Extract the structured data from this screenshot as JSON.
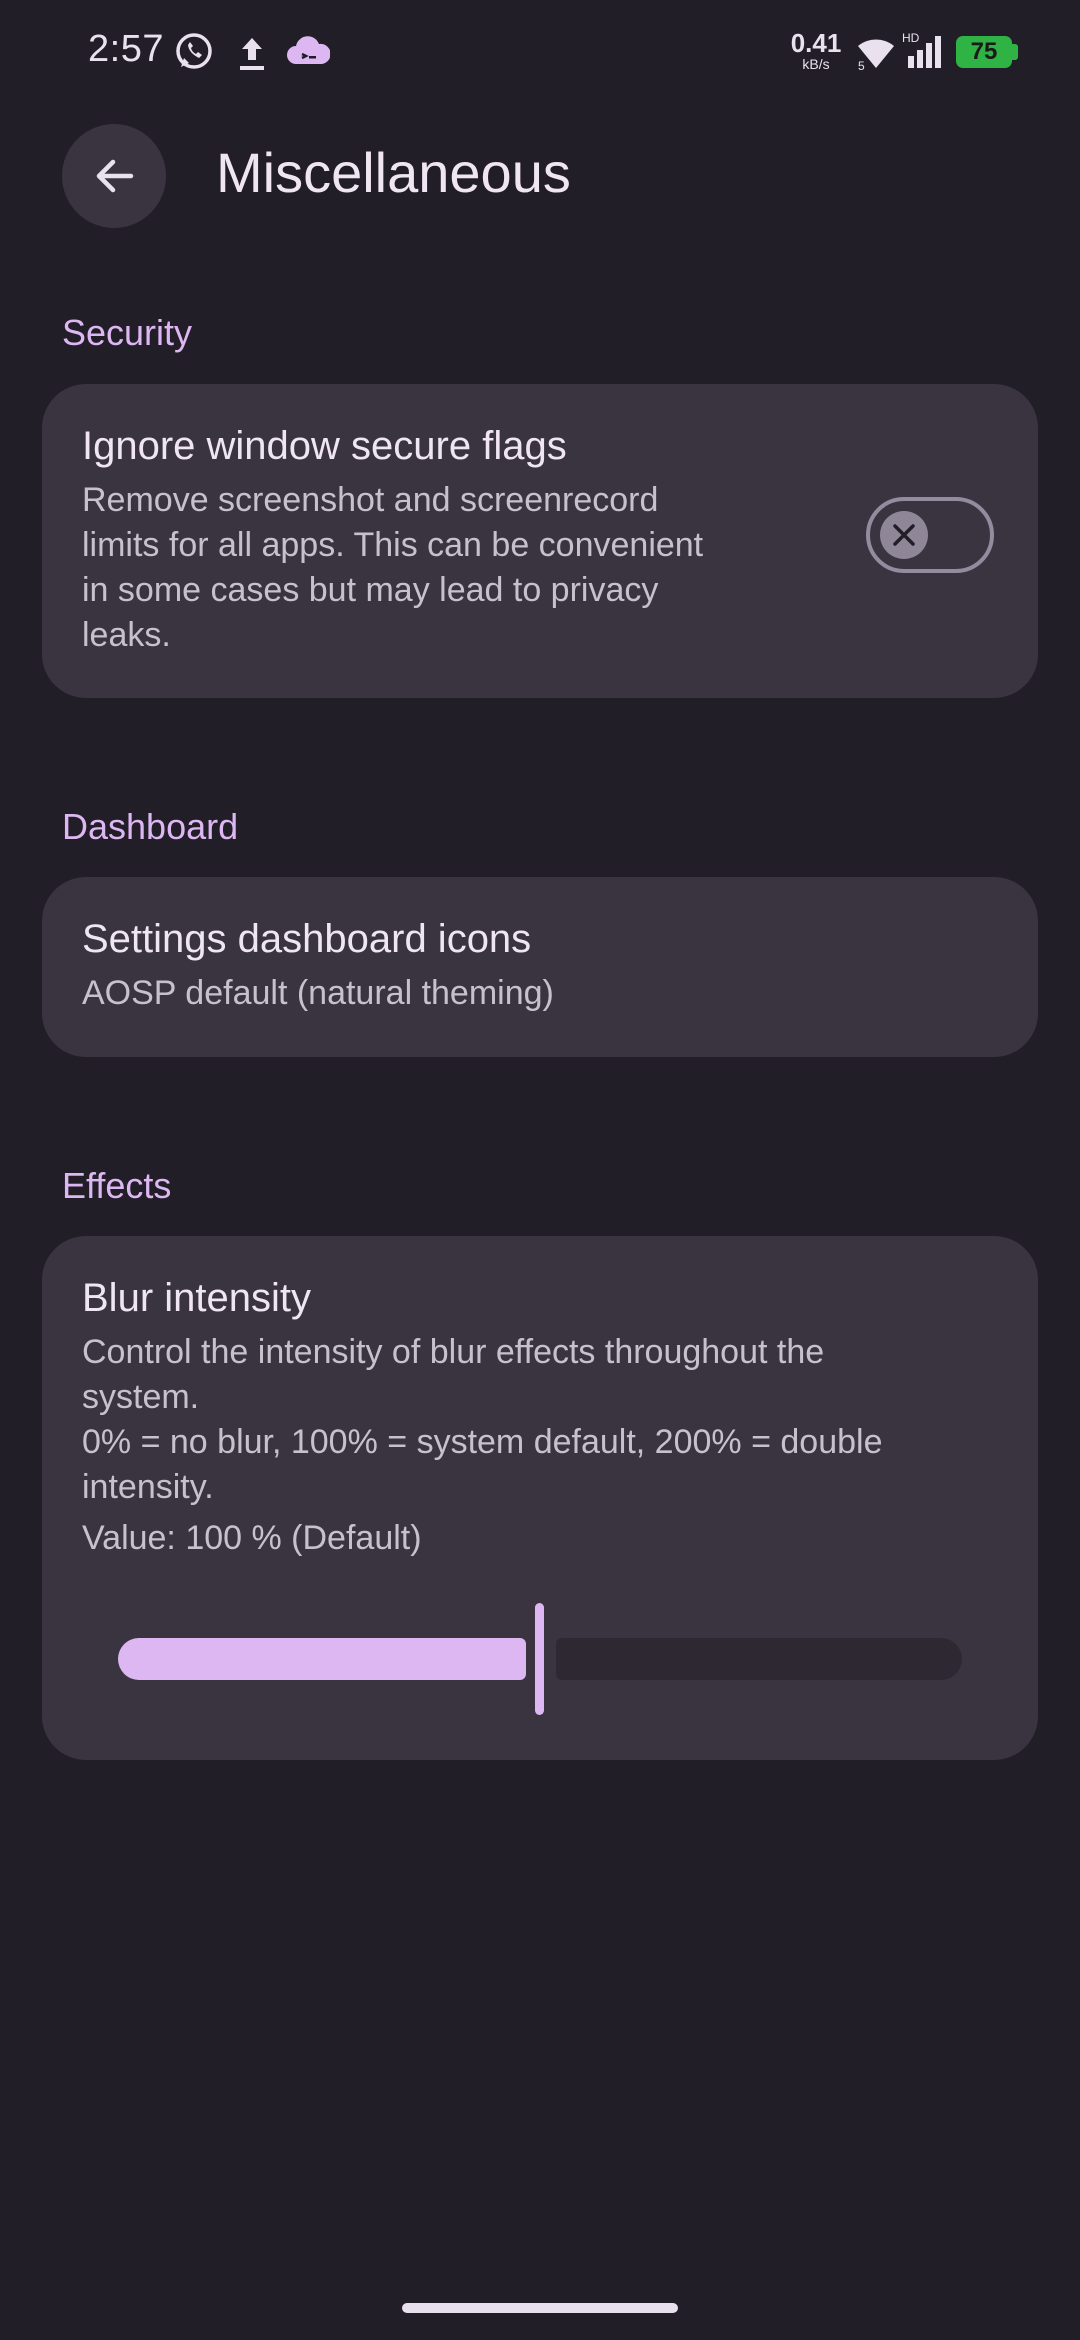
{
  "status_bar": {
    "time": "2:57",
    "net_speed_value": "0.41",
    "net_speed_unit": "kB/s",
    "battery": "75",
    "icons": [
      "whatsapp-icon",
      "upload-icon",
      "cloud-app-icon",
      "wifi-icon",
      "signal-icon",
      "battery-charging-icon"
    ]
  },
  "app_bar": {
    "title": "Miscellaneous",
    "back_icon": "arrow-back-icon"
  },
  "security": {
    "header": "Security",
    "item": {
      "title": "Ignore window secure flags",
      "summary": "Remove screenshot and screenrecord\nlimits for all apps. This can be convenient\nin some cases but may lead to privacy\nleaks.",
      "toggle_on": false
    }
  },
  "dashboard": {
    "header": "Dashboard",
    "item": {
      "title": "Settings dashboard icons",
      "summary": "AOSP default (natural theming)"
    }
  },
  "effects": {
    "header": "Effects",
    "item": {
      "title": "Blur intensity",
      "summary": "Control the intensity of blur effects throughout the\nsystem.\n0% = no blur, 100% = system default, 200% = double\nintensity.",
      "value_text": "Value: 100 % (Default)",
      "slider_value_percent": 100,
      "slider_max_percent": 200
    }
  },
  "colors": {
    "background": "#221e28",
    "card": "#3a3440",
    "accent": "#dcb7f2",
    "battery": "#2fb344"
  }
}
